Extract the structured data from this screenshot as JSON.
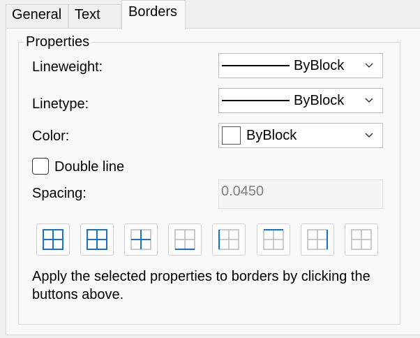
{
  "tabs": [
    {
      "label": "General"
    },
    {
      "label": "Text"
    },
    {
      "label": "Borders"
    }
  ],
  "group_title": "Properties",
  "lineweight": {
    "label": "Lineweight:",
    "value": "ByBlock"
  },
  "linetype": {
    "label": "Linetype:",
    "value": "ByBlock"
  },
  "color": {
    "label": "Color:",
    "value": "ByBlock",
    "swatch": "#ffffff"
  },
  "double_line": {
    "label": "Double line",
    "checked": false
  },
  "spacing": {
    "label": "Spacing:",
    "value": "0.0450"
  },
  "border_buttons": [
    {
      "name": "all-borders"
    },
    {
      "name": "outside-borders"
    },
    {
      "name": "inside-borders"
    },
    {
      "name": "bottom-border"
    },
    {
      "name": "left-border"
    },
    {
      "name": "top-border"
    },
    {
      "name": "right-border"
    },
    {
      "name": "no-border"
    }
  ],
  "description": "Apply the selected properties to borders by clicking the buttons above.",
  "colors": {
    "accent": "#1a73c8",
    "grid_light": "#b9b9b9"
  }
}
